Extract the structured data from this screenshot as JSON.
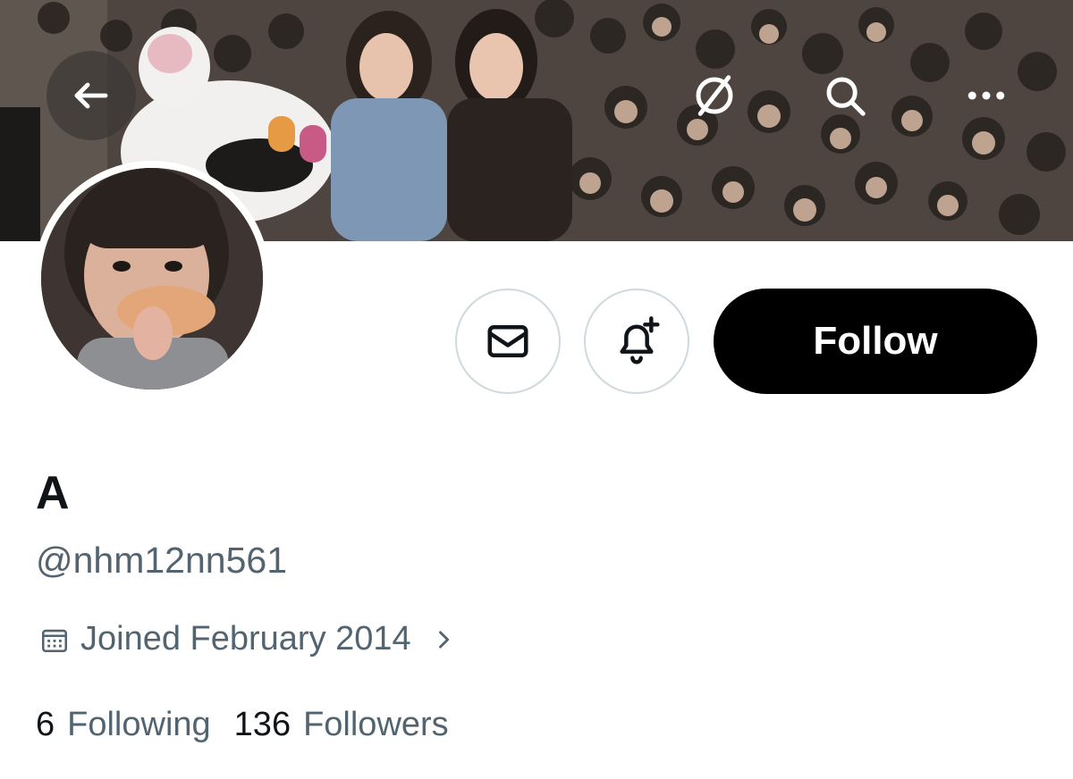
{
  "header": {
    "back_icon": "arrow-left-icon",
    "hide_icon": "eye-slash-icon",
    "search_icon": "search-icon",
    "more_icon": "more-horizontal-icon"
  },
  "actions": {
    "message_icon": "envelope-icon",
    "notify_icon": "bell-plus-icon",
    "follow_label": "Follow"
  },
  "profile": {
    "display_name": "A",
    "handle": "@nhm12nn561",
    "joined": "Joined February 2014",
    "joined_icon": "calendar-icon"
  },
  "stats": {
    "following_count": "6",
    "following_label": "Following",
    "followers_count": "136",
    "followers_label": "Followers"
  },
  "colors": {
    "follow_bg": "#000000",
    "secondary_text": "#536471",
    "border": "#cfd9de"
  }
}
